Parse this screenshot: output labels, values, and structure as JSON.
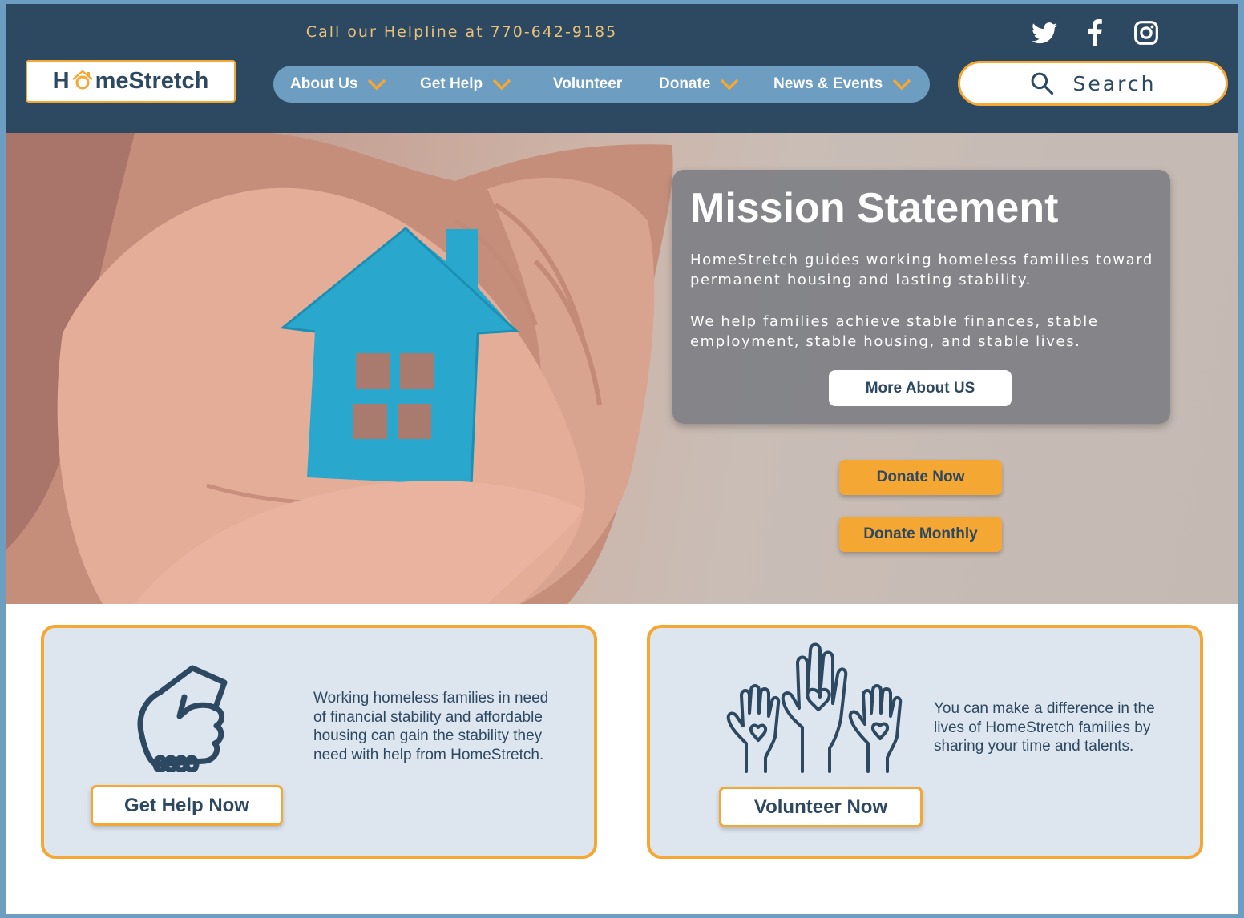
{
  "header": {
    "helpline": "Call our Helpline at 770-642-9185",
    "logo": {
      "prefix": "H",
      "suffix": "meStretch"
    },
    "social": [
      "twitter-icon",
      "facebook-icon",
      "instagram-icon"
    ],
    "search_label": "Search"
  },
  "nav": {
    "items": [
      {
        "label": "About Us",
        "has_dropdown": true
      },
      {
        "label": "Get Help",
        "has_dropdown": true
      },
      {
        "label": "Volunteer",
        "has_dropdown": false
      },
      {
        "label": "Donate",
        "has_dropdown": true
      },
      {
        "label": "News & Events",
        "has_dropdown": true
      }
    ]
  },
  "hero": {
    "title": "Mission Statement",
    "paragraph1": "HomeStretch guides working homeless families toward permanent housing and lasting stability.",
    "paragraph2": "We help families achieve stable finances, stable employment, stable housing, and stable lives.",
    "more_button": "More About US",
    "donate_now": "Donate Now",
    "donate_monthly": "Donate Monthly"
  },
  "cards": {
    "help": {
      "text": "Working homeless families in need of financial stability and affordable housing can gain the stability they need with help from HomeStretch.",
      "button": "Get Help Now",
      "icon": "handshake-icon"
    },
    "volunteer": {
      "text": "You can make a difference in the lives of HomeStretch families by sharing your time and talents.",
      "button": "Volunteer Now",
      "icon": "raised-hands-heart-icon"
    }
  },
  "colors": {
    "navy": "#2d4861",
    "accent_orange": "#f5a733",
    "nav_blue": "#6d9dc0",
    "card_bg": "#dde6ef",
    "helpline_text": "#e8c27a"
  }
}
